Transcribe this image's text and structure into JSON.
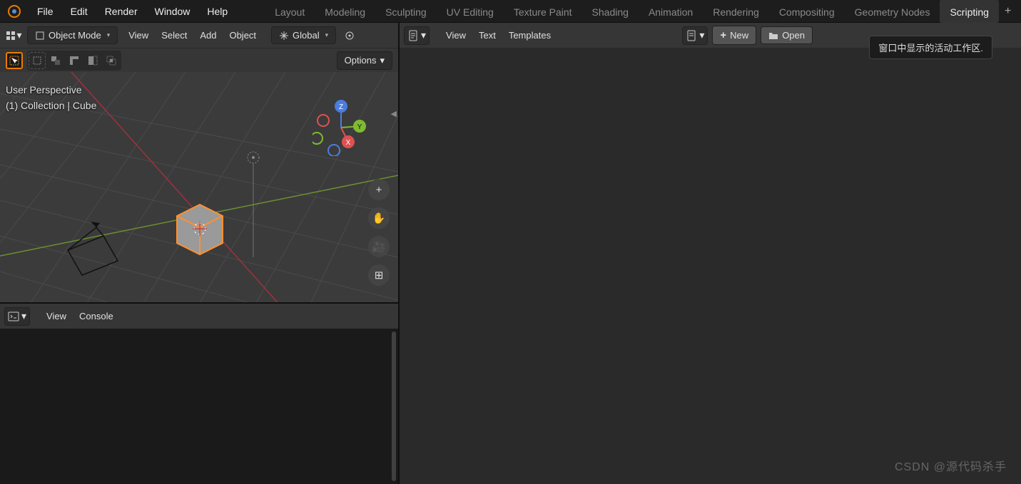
{
  "topbar": {
    "menus": [
      "File",
      "Edit",
      "Render",
      "Window",
      "Help"
    ],
    "workspaces": [
      "Layout",
      "Modeling",
      "Sculpting",
      "UV Editing",
      "Texture Paint",
      "Shading",
      "Animation",
      "Rendering",
      "Compositing",
      "Geometry Nodes",
      "Scripting"
    ],
    "active_workspace": "Scripting",
    "add_tab": "+"
  },
  "viewport_header": {
    "mode": "Object Mode",
    "menus": [
      "View",
      "Select",
      "Add",
      "Object"
    ],
    "orientation": "Global",
    "options_label": "Options"
  },
  "viewport_overlay": {
    "line1": "User Perspective",
    "line2": "(1) Collection | Cube"
  },
  "nav_axes": {
    "x": "X",
    "y": "Y",
    "z": "Z"
  },
  "side_gizmos": [
    {
      "name": "zoom-icon",
      "glyph": "+"
    },
    {
      "name": "pan-icon",
      "glyph": "✋"
    },
    {
      "name": "camera-icon",
      "glyph": "🎥"
    },
    {
      "name": "grid-icon",
      "glyph": "⊞"
    }
  ],
  "console": {
    "menus": [
      "View",
      "Console"
    ]
  },
  "text_editor": {
    "menus": [
      "View",
      "Text",
      "Templates"
    ],
    "new_label": "New",
    "open_label": "Open"
  },
  "tooltip": "窗口中显示的活动工作区.",
  "watermark": "CSDN @源代码杀手"
}
